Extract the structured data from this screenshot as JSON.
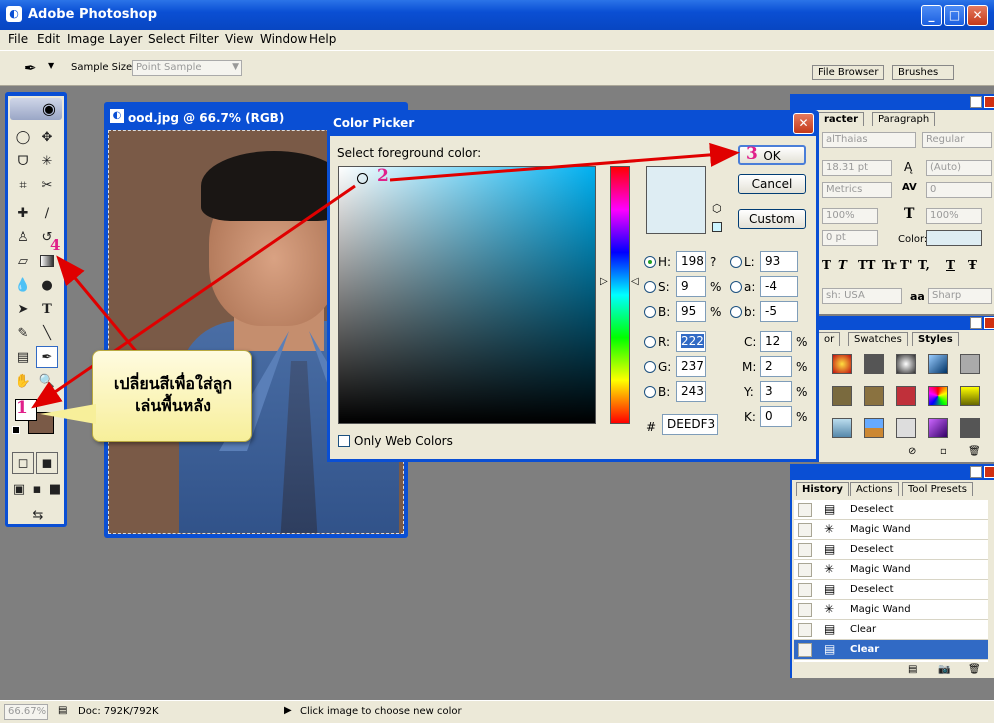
{
  "app": {
    "title": "Adobe Photoshop"
  },
  "menu": [
    "File",
    "Edit",
    "Image",
    "Layer",
    "Select",
    "Filter",
    "View",
    "Window",
    "Help"
  ],
  "options": {
    "sample_size_label": "Sample Size:",
    "sample_size_value": "Point Sample",
    "tab_file_browser": "File Browser",
    "tab_brushes": "Brushes"
  },
  "document": {
    "title": "ood.jpg @ 66.7% (RGB)"
  },
  "color_picker": {
    "title": "Color Picker",
    "prompt": "Select foreground color:",
    "ok": "OK",
    "cancel": "Cancel",
    "custom": "Custom",
    "only_web_colors": "Only Web Colors",
    "hex_symbol": "#",
    "hex": "DEEDF3",
    "new_color": "#deedf3",
    "fields": {
      "H": {
        "label": "H:",
        "value": "198",
        "unit": "?"
      },
      "S": {
        "label": "S:",
        "value": "9",
        "unit": "%"
      },
      "B": {
        "label": "B:",
        "value": "95",
        "unit": "%"
      },
      "R": {
        "label": "R:",
        "value": "222"
      },
      "G": {
        "label": "G:",
        "value": "237"
      },
      "Bl": {
        "label": "B:",
        "value": "243"
      },
      "L": {
        "label": "L:",
        "value": "93"
      },
      "a": {
        "label": "a:",
        "value": "-4"
      },
      "b": {
        "label": "b:",
        "value": "-5"
      },
      "C": {
        "label": "C:",
        "value": "12",
        "unit": "%"
      },
      "M": {
        "label": "M:",
        "value": "2",
        "unit": "%"
      },
      "Y": {
        "label": "Y:",
        "value": "3",
        "unit": "%"
      },
      "K": {
        "label": "K:",
        "value": "0",
        "unit": "%"
      }
    }
  },
  "character_panel": {
    "tab_character": "racter",
    "tab_paragraph": "Paragraph",
    "font_family": "alThaias",
    "font_style": "Regular",
    "size": "18.31 pt",
    "leading": "(Auto)",
    "kerning": "Metrics",
    "tracking": "0",
    "vscale": "100%",
    "hscale": "100%",
    "baseline": "0 pt",
    "color_label": "Color:",
    "style_buttons": [
      "T",
      "T",
      "TT",
      "Tr",
      "T'",
      "T,",
      "T",
      "Ŧ"
    ],
    "language": "sh: USA",
    "aa_icon": "aa",
    "antialias": "Sharp"
  },
  "styles_panel": {
    "tab_color": "or",
    "tab_swatches": "Swatches",
    "tab_styles": "Styles"
  },
  "history_panel": {
    "tabs": [
      "History",
      "Actions",
      "Tool Presets"
    ],
    "items": [
      "Deselect",
      "Magic Wand",
      "Deselect",
      "Magic Wand",
      "Deselect",
      "Magic Wand",
      "Clear",
      "Clear"
    ]
  },
  "status": {
    "zoom": "66.67%",
    "doc": "Doc: 792K/792K",
    "hint": "Click image to choose new color"
  },
  "annotations": {
    "callout": "เปลี่ยนสีเพื่อใส่ลูกเล่นพื้นหลัง",
    "n1": "1",
    "n2": "2",
    "n3": "3",
    "n4": "4"
  },
  "colors": {
    "foreground": "#ffffff",
    "background": "#7a5a47",
    "accent": "#0a4fd4",
    "arrow": "#e00000"
  }
}
